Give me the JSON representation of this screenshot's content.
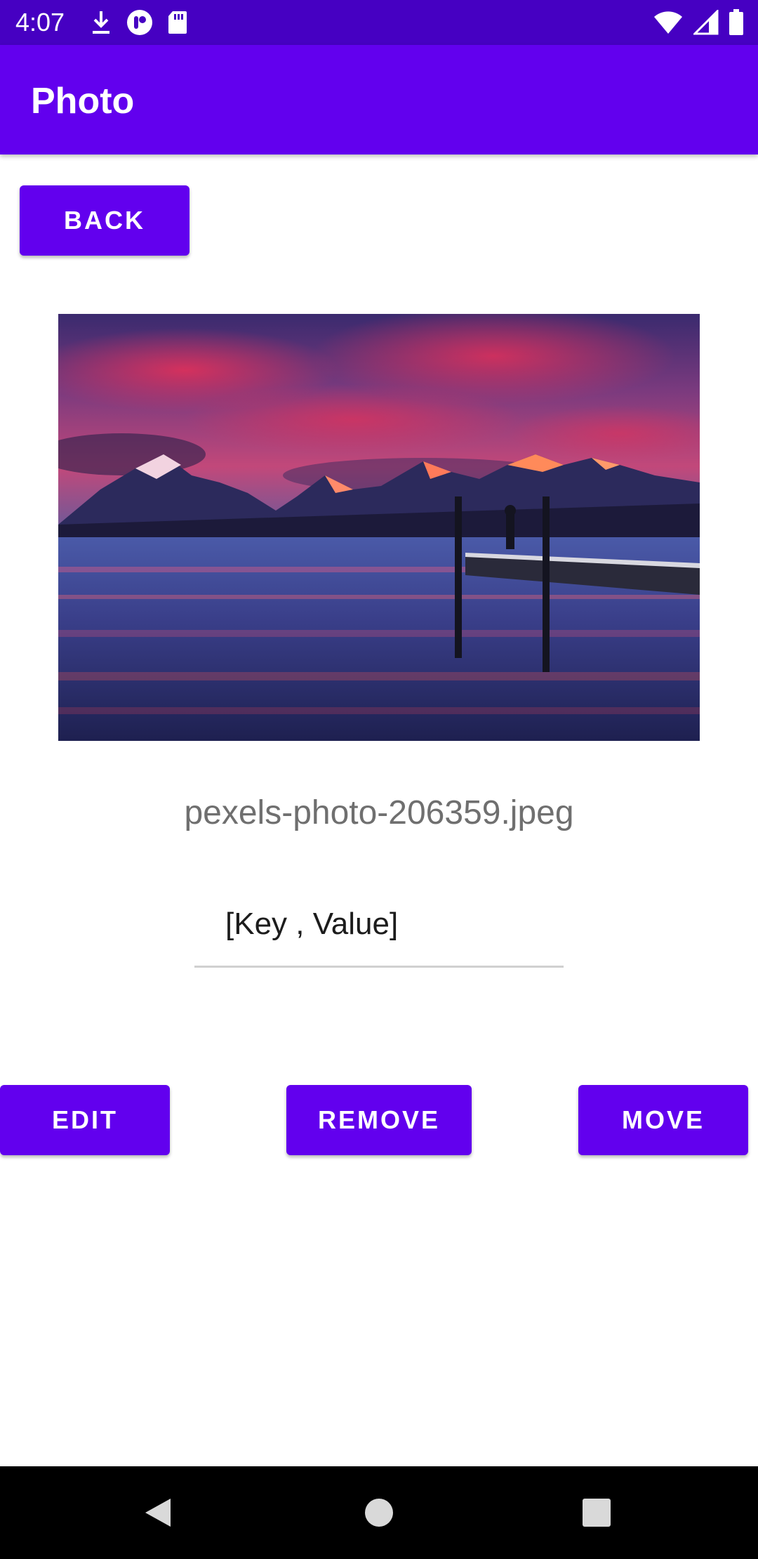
{
  "status_bar": {
    "time": "4:07",
    "left_icons": [
      "download-icon",
      "vpn-app-icon",
      "sd-card-icon"
    ],
    "right_icons": [
      "wifi-icon",
      "cell-signal-icon",
      "battery-icon"
    ]
  },
  "app_bar": {
    "title": "Photo"
  },
  "back_button": {
    "label": "BACK"
  },
  "photo": {
    "filename": "pexels-photo-206359.jpeg"
  },
  "tag_field": {
    "value": "[Key , Value]"
  },
  "actions": {
    "edit_label": "EDIT",
    "remove_label": "REMOVE",
    "move_label": "MOVE"
  },
  "nav_bar": {
    "icons": [
      "back-triangle-icon",
      "home-circle-icon",
      "recents-square-icon"
    ]
  },
  "colors": {
    "status_bar": "#4600c2",
    "primary": "#6200ee",
    "on_primary": "#ffffff",
    "filename_text": "#6f6f6f"
  }
}
